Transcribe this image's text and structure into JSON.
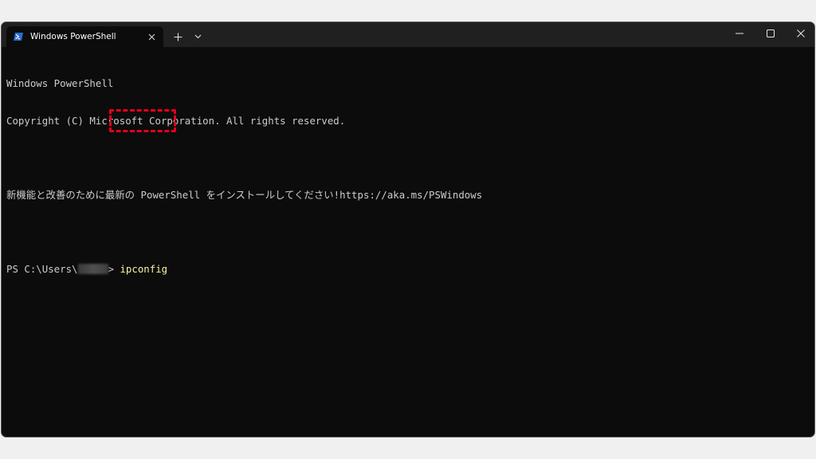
{
  "window": {
    "tab_title": "Windows PowerShell",
    "accent_color": "#e3001b",
    "terminal_bg": "#0c0c0c",
    "command_color": "#f9f1a5"
  },
  "titlebar": {
    "new_tab_icon": "plus-icon",
    "dropdown_icon": "chevron-down-icon",
    "minimize_icon": "minimize-icon",
    "maximize_icon": "maximize-icon",
    "close_icon": "close-icon"
  },
  "terminal": {
    "lines": [
      "Windows PowerShell",
      "Copyright (C) Microsoft Corporation. All rights reserved.",
      "",
      "新機能と改善のために最新の PowerShell をインストールしてください!https://aka.ms/PSWindows",
      ""
    ],
    "prompt_prefix": "PS C:\\Users\\",
    "prompt_suffix": "> ",
    "command": "ipconfig"
  }
}
